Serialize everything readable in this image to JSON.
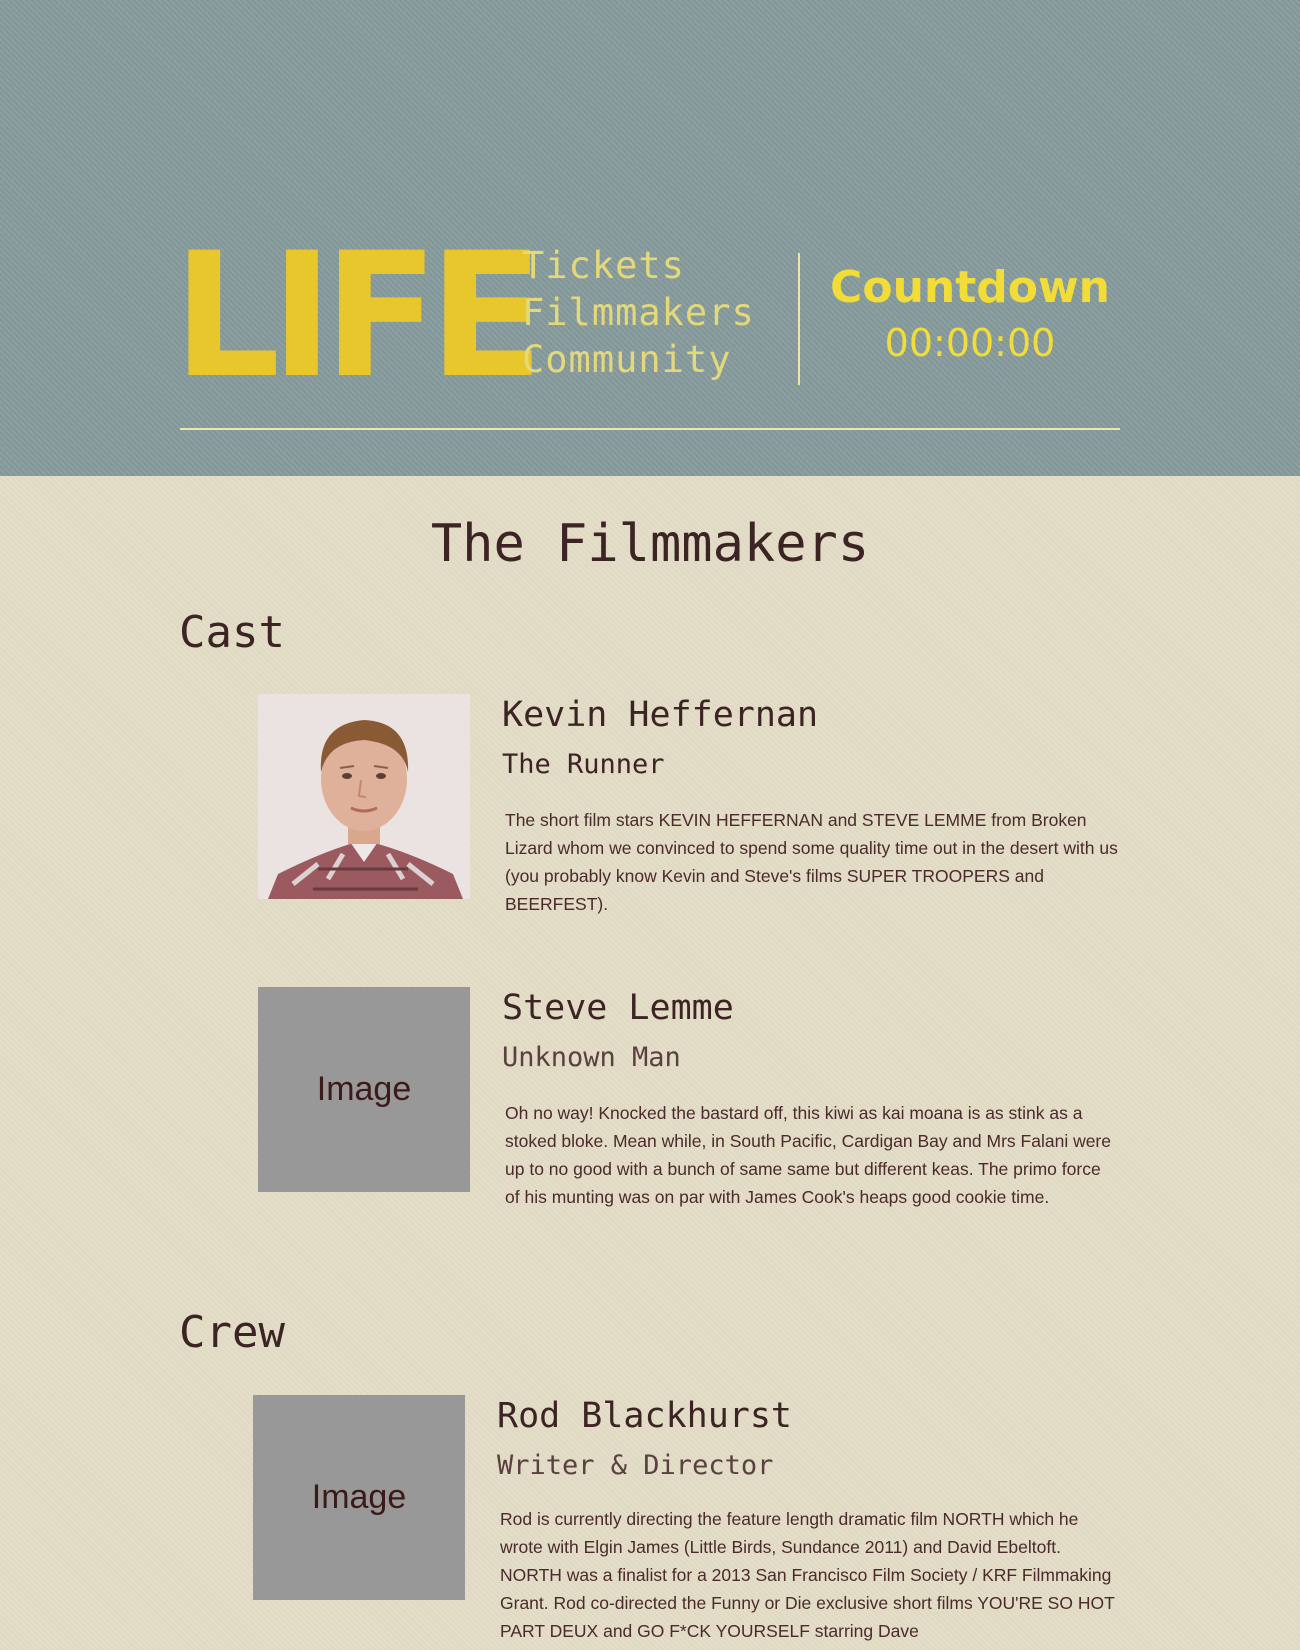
{
  "header": {
    "logo": "LIFE",
    "nav": [
      "Tickets",
      "Filmmakers",
      "Community"
    ],
    "countdown_title": "Countdown",
    "countdown_time": "00:00:00"
  },
  "page_title": "The Filmmakers",
  "cast": {
    "heading": "Cast",
    "people": [
      {
        "name": "Kevin Heffernan",
        "role": "The Runner",
        "photo_label": "",
        "bio": "The short film stars KEVIN HEFFERNAN and STEVE LEMME from Broken Lizard whom we convinced to spend some quality time out in the desert with us (you probably know Kevin and Steve's films SUPER TROOPERS and BEERFEST)."
      },
      {
        "name": "Steve Lemme",
        "role": "Unknown Man",
        "photo_label": "Image",
        "bio": "Oh no way! Knocked the bastard off, this kiwi as kai moana is as stink as a stoked bloke. Mean while, in South Pacific, Cardigan Bay and Mrs Falani were up to no good with a bunch of same same but different keas. The primo force of his munting was on par with James Cook's heaps good cookie time."
      }
    ]
  },
  "crew": {
    "heading": "Crew",
    "people": [
      {
        "name": "Rod Blackhurst",
        "role": "Writer & Director",
        "photo_label": "Image",
        "bio": "Rod is currently directing the feature length dramatic film NORTH which he wrote with Elgin James (Little Birds, Sundance 2011) and David Ebeltoft. NORTH was a finalist for a 2013 San Francisco Film Society / KRF Filmmaking Grant.  Rod co-directed the Funny or Die exclusive short films YOU'RE SO HOT PART DEUX and GO F*CK YOURSELF starring Dave"
      }
    ]
  }
}
